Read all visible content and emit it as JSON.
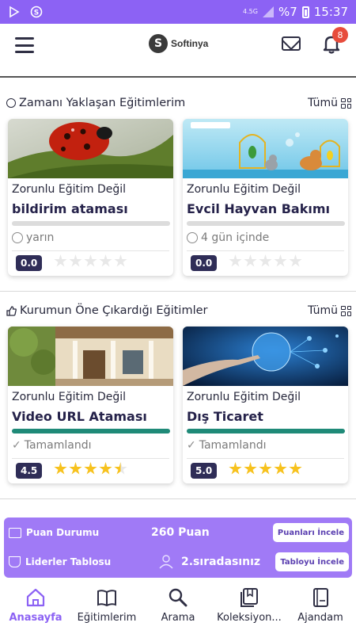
{
  "status_bar": {
    "network": "4.5G",
    "battery_percent": "%7",
    "time": "15:37"
  },
  "app_bar": {
    "logo_letter": "S",
    "logo_text": "Softinya",
    "notification_count": "8",
    "icons": [
      "menu-icon",
      "mail-icon",
      "bell-icon"
    ]
  },
  "sections": [
    {
      "title": "Zamanı Yaklaşan Eğitimlerim",
      "all_label": "Tümü",
      "cards": [
        {
          "subtitle": "Zorunlu Eğitim Değil",
          "title": "bildirim ataması",
          "progress": 0,
          "status": "yarın",
          "status_icon": "clock-icon",
          "rating": "0.0",
          "stars": 0
        },
        {
          "subtitle": "Zorunlu Eğitim Değil",
          "title": "Evcil Hayvan Bakımı",
          "progress": 0,
          "status": "4 gün içinde",
          "status_icon": "clock-icon",
          "rating": "0.0",
          "stars": 0
        }
      ]
    },
    {
      "title": "Kurumun Öne Çıkardığı Eğitimler",
      "all_label": "Tümü",
      "cards": [
        {
          "subtitle": "Zorunlu Eğitim Değil",
          "title": "Video URL Ataması",
          "progress": 1,
          "status": "Tamamlandı",
          "status_icon": "check-icon",
          "rating": "4.5",
          "stars": 4.5
        },
        {
          "subtitle": "Zorunlu Eğitim Değil",
          "title": "Dış Ticaret",
          "progress": 1,
          "status": "Tamamlandı",
          "status_icon": "check-icon",
          "rating": "5.0",
          "stars": 5
        }
      ]
    }
  ],
  "points_panel": {
    "score_label": "Puan Durumu",
    "score_value": "260 Puan",
    "score_button": "Puanları İncele",
    "leader_label": "Liderler Tablosu",
    "leader_value": "2.sıradasınız",
    "leader_button": "Tabloyu İncele"
  },
  "bottom_nav": [
    {
      "label": "Anasayfa",
      "icon": "home-icon",
      "active": true
    },
    {
      "label": "Eğitimlerim",
      "icon": "book-icon",
      "active": false
    },
    {
      "label": "Arama",
      "icon": "search-icon",
      "active": false
    },
    {
      "label": "Koleksiyon...",
      "icon": "collection-icon",
      "active": false
    },
    {
      "label": "Ajandam",
      "icon": "agenda-icon",
      "active": false
    }
  ],
  "colors": {
    "accent": "#8c62f4",
    "panel": "#a07af6",
    "progress_fill": "#1f8a78",
    "rating_badge": "#2f2d57",
    "star": "#f7c21e"
  }
}
